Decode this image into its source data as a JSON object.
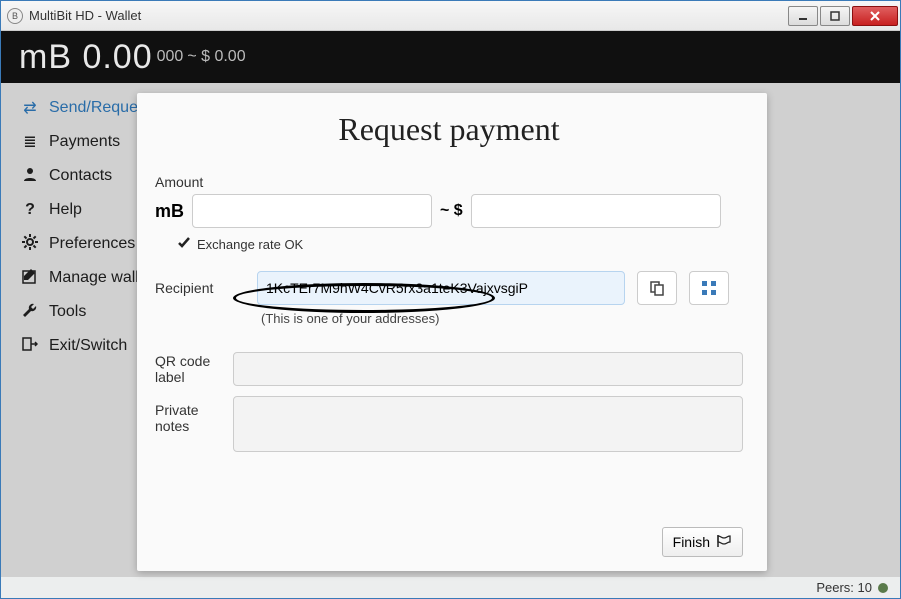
{
  "window": {
    "title": "MultiBit HD - Wallet"
  },
  "balance": {
    "prefix_big": "mB 0.00",
    "prefix_small": " 000",
    "approx": " ~ $ 0.00"
  },
  "sidebar": {
    "items": [
      {
        "label": "Send/Request"
      },
      {
        "label": "Payments"
      },
      {
        "label": "Contacts"
      },
      {
        "label": "Help"
      },
      {
        "label": "Preferences"
      },
      {
        "label": "Manage wallet"
      },
      {
        "label": "Tools"
      },
      {
        "label": "Exit/Switch"
      }
    ]
  },
  "modal": {
    "title": "Request payment",
    "amount_label": "Amount",
    "amount_prefix": "mB",
    "amount_value": "",
    "tilde": "~ $",
    "usd_value": "",
    "xrate": "Exchange rate OK",
    "recipient_label": "Recipient",
    "recipient_value": "1KcTEr7M9hW4CvR5rx3a1teK3VajxvsgiP",
    "recipient_note": "(This is one of your addresses)",
    "qr_label": "QR code label",
    "qr_value": "",
    "notes_label": "Private notes",
    "notes_value": "",
    "finish": "Finish"
  },
  "status": {
    "peers": "Peers: 10"
  }
}
